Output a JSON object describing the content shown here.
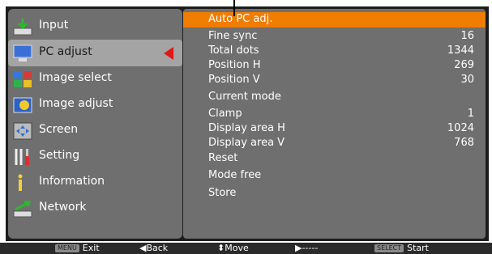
{
  "menu": {
    "items": [
      {
        "label": "Input",
        "icon": "input-arrow-icon"
      },
      {
        "label": "PC adjust",
        "icon": "monitor-icon"
      },
      {
        "label": "Image select",
        "icon": "image-select-icon"
      },
      {
        "label": "Image adjust",
        "icon": "image-adjust-icon"
      },
      {
        "label": "Screen",
        "icon": "screen-icon"
      },
      {
        "label": "Setting",
        "icon": "tools-icon"
      },
      {
        "label": "Information",
        "icon": "info-icon"
      },
      {
        "label": "Network",
        "icon": "network-icon"
      }
    ],
    "selected_index": 1
  },
  "submenu": {
    "rows": [
      {
        "label": "Auto PC adj.",
        "value": ""
      },
      {
        "label": "Fine sync",
        "value": "16"
      },
      {
        "label": "Total dots",
        "value": "1344"
      },
      {
        "label": "Position H",
        "value": "269"
      },
      {
        "label": "Position V",
        "value": "30"
      },
      {
        "label": "Current mode",
        "value": ""
      },
      {
        "label": "Clamp",
        "value": "1"
      },
      {
        "label": "Display area H",
        "value": "1024"
      },
      {
        "label": "Display area V",
        "value": "768"
      },
      {
        "label": "Reset",
        "value": ""
      },
      {
        "label": "Mode free",
        "value": ""
      },
      {
        "label": "Store",
        "value": ""
      }
    ],
    "highlight_index": 0
  },
  "help": {
    "exit_key": "MENU",
    "exit_label": "Exit",
    "back_label": "◀Back",
    "move_label": "⬍Move",
    "next_label": "▶-----",
    "start_key": "SELECT",
    "start_label": "Start"
  },
  "colors": {
    "panel": "#6f6f6f",
    "highlight": "#f07c00",
    "selected_menu": "#a4a4a4",
    "arrow": "#e01818"
  }
}
